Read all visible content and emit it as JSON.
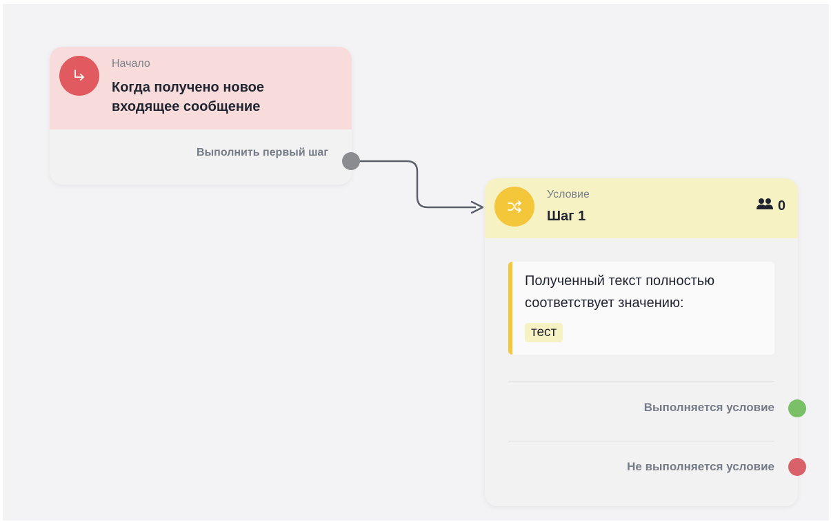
{
  "start_node": {
    "type_label": "Начало",
    "title": "Когда получено новое входящее сообщение",
    "output_label": "Выполнить первый шаг",
    "icon": "arrow-turn-right-icon",
    "accent_color": "#e05a5f",
    "header_color": "#f8dcdc"
  },
  "condition_node": {
    "type_label": "Условие",
    "title": "Шаг 1",
    "icon": "shuffle-icon",
    "users_icon": "users-icon",
    "users_count": "0",
    "accent_color": "#f4c63a",
    "header_color": "#f6f2c4",
    "rule": {
      "text": "Полученный текст полностью соответствует значению:",
      "value": "тест"
    },
    "outputs": {
      "true_label": "Выполняется условие",
      "true_color": "#79c066",
      "false_label": "Не выполняется условие",
      "false_color": "#d9626a"
    }
  },
  "connector_color": "#5a5f6a"
}
